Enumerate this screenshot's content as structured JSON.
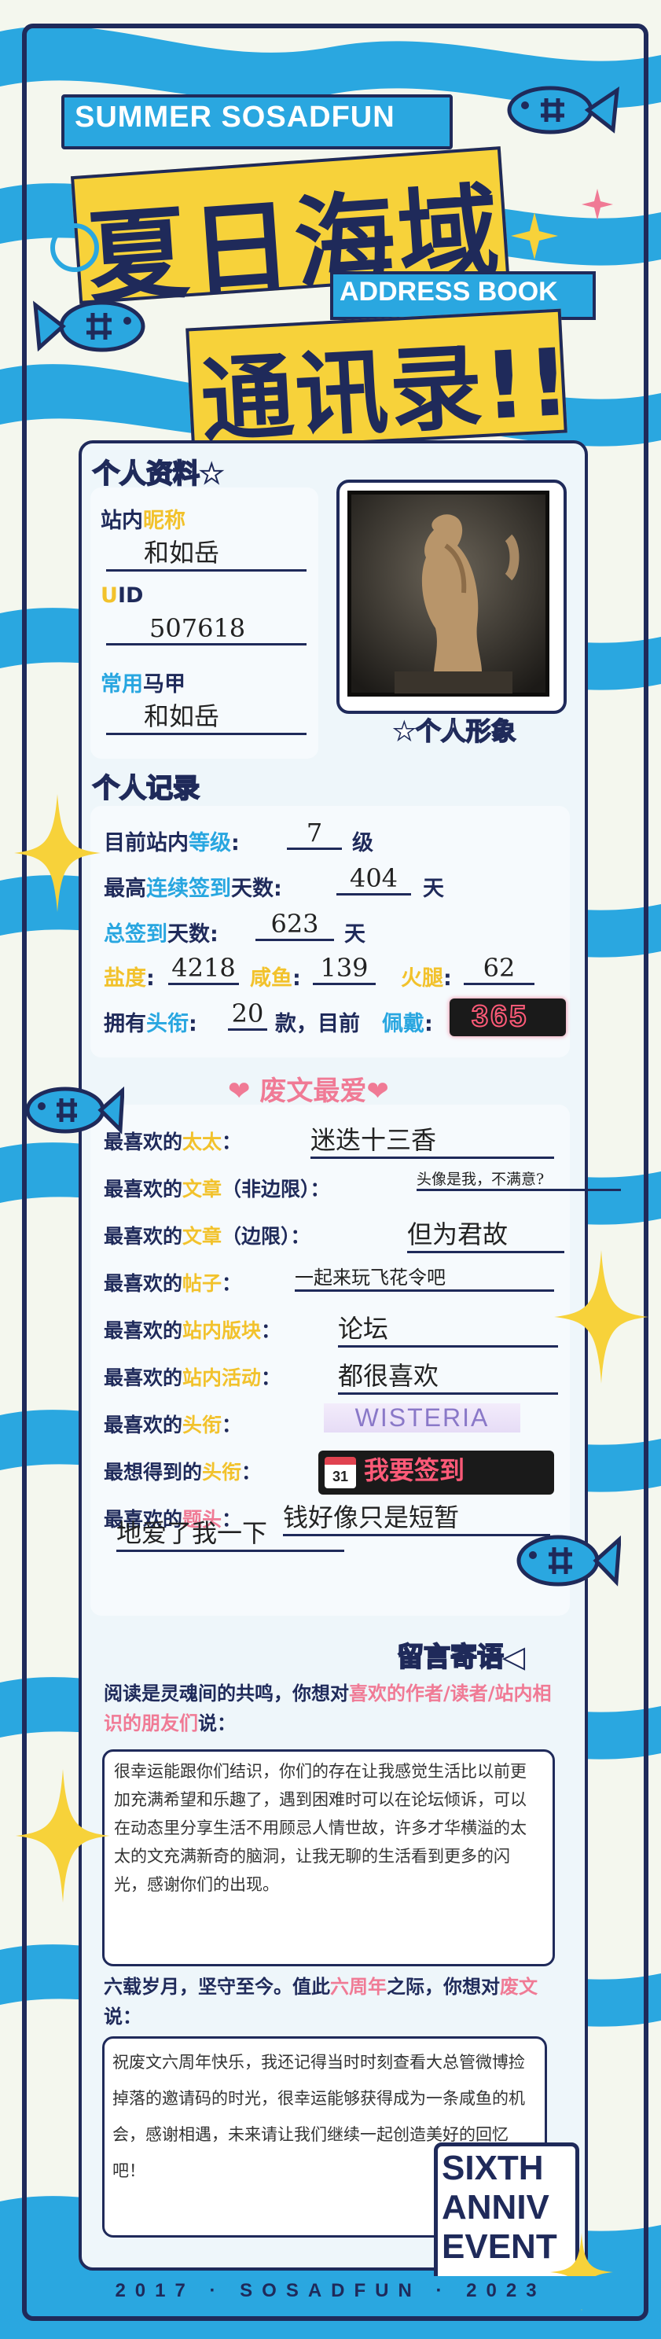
{
  "header": {
    "top_banner": "SUMMER SOSADFUN",
    "title_line1": "夏日海域",
    "address_book": "ADDRESS BOOK",
    "title_line2": "通讯录!!"
  },
  "profile": {
    "section_title": "个人资料★",
    "nickname_label_a": "站内",
    "nickname_label_b": "昵称",
    "nickname_value": "和如岳",
    "uid_label_a": "U",
    "uid_label_b": "ID",
    "uid_value": "507618",
    "alias_label_a": "常用",
    "alias_label_b": "马甲",
    "alias_value": "和如岳",
    "avatar_caption": "★个人形象"
  },
  "records": {
    "section_title": "个人记录",
    "level_label_a": "目前站内",
    "level_label_b": "等级",
    "level_value": "7",
    "level_unit": "级",
    "streak_label_a": "最高",
    "streak_label_b": "连续签到",
    "streak_label_c": "天数:",
    "streak_value": "404",
    "streak_unit": "天",
    "total_label_a": "总签到",
    "total_label_b": "天数:",
    "total_value": "623",
    "total_unit": "天",
    "salt_label": "盐度",
    "salt_value": "4218",
    "fish_label": "咸鱼",
    "fish_value": "139",
    "ham_label": "火腿",
    "ham_value": "62",
    "titles_label_a": "拥有",
    "titles_label_b": "头衔",
    "titles_value": "20",
    "titles_unit": "款，目前",
    "wearing_label": "佩戴",
    "badge_text": "365"
  },
  "favorites": {
    "section_title": "❤ 废文最爱❤",
    "rows": [
      {
        "label": "最喜欢的太太：",
        "value": "迷迭十三香"
      },
      {
        "label": "最喜欢的文章（非边限）：",
        "value": "头像是我，不满意?"
      },
      {
        "label": "最喜欢的文章（边限）：",
        "value": "但为君故"
      },
      {
        "label": "最喜欢的帖子：",
        "value": "一起来玩飞花令吧"
      },
      {
        "label": "最喜欢的站内版块：",
        "value": "论坛"
      },
      {
        "label": "最喜欢的站内活动：",
        "value": "都很喜欢"
      },
      {
        "label": "最喜欢的头衔：",
        "value": "WISTERIA"
      },
      {
        "label": "最想得到的头衔：",
        "value": "我要签到"
      },
      {
        "label": "最喜欢的题头：",
        "value": "钱好像只是短暂"
      }
    ],
    "extra_line": "地爱了我一下",
    "calendar_day": "31"
  },
  "messages": {
    "section_title": "留言寄语◀",
    "q1_a": "阅读是灵魂间的共鸣，你想对",
    "q1_b": "喜欢的作者/读者/站内相识的朋友们",
    "q1_c": "说：",
    "a1": "很幸运能跟你们结识，你们的存在让我感觉生活比以前更加充满希望和乐趣了，遇到困难时可以在论坛倾诉，可以在动态里分享生活不用顾忌人情世故，许多才华横溢的太太的文充满新奇的脑洞，让我无聊的生活看到更多的闪光，感谢你们的出现。",
    "q2_a": "六载岁月，坚守至今。值此",
    "q2_b": "六周年",
    "q2_c": "之际，你想对",
    "q2_d": "废文",
    "q2_e": "说：",
    "a2": "祝废文六周年快乐，我还记得当时时刻查看大总管微博捡掉落的邀请码的时光，很幸运能够获得成为一条咸鱼的机会，感谢相遇，未来请让我们继续一起创造美好的回忆吧！",
    "stamp_l1": "SIXTH",
    "stamp_l2": "ANNIV",
    "stamp_l3": "EVENT"
  },
  "footer": {
    "text": "2017 · SOSADFUN · 2023"
  },
  "colors": {
    "navy": "#1f2a5a",
    "sky": "#2aa7e0",
    "yellow": "#f7d23a",
    "pink": "#f07a95",
    "cream": "#f4f7ee"
  }
}
